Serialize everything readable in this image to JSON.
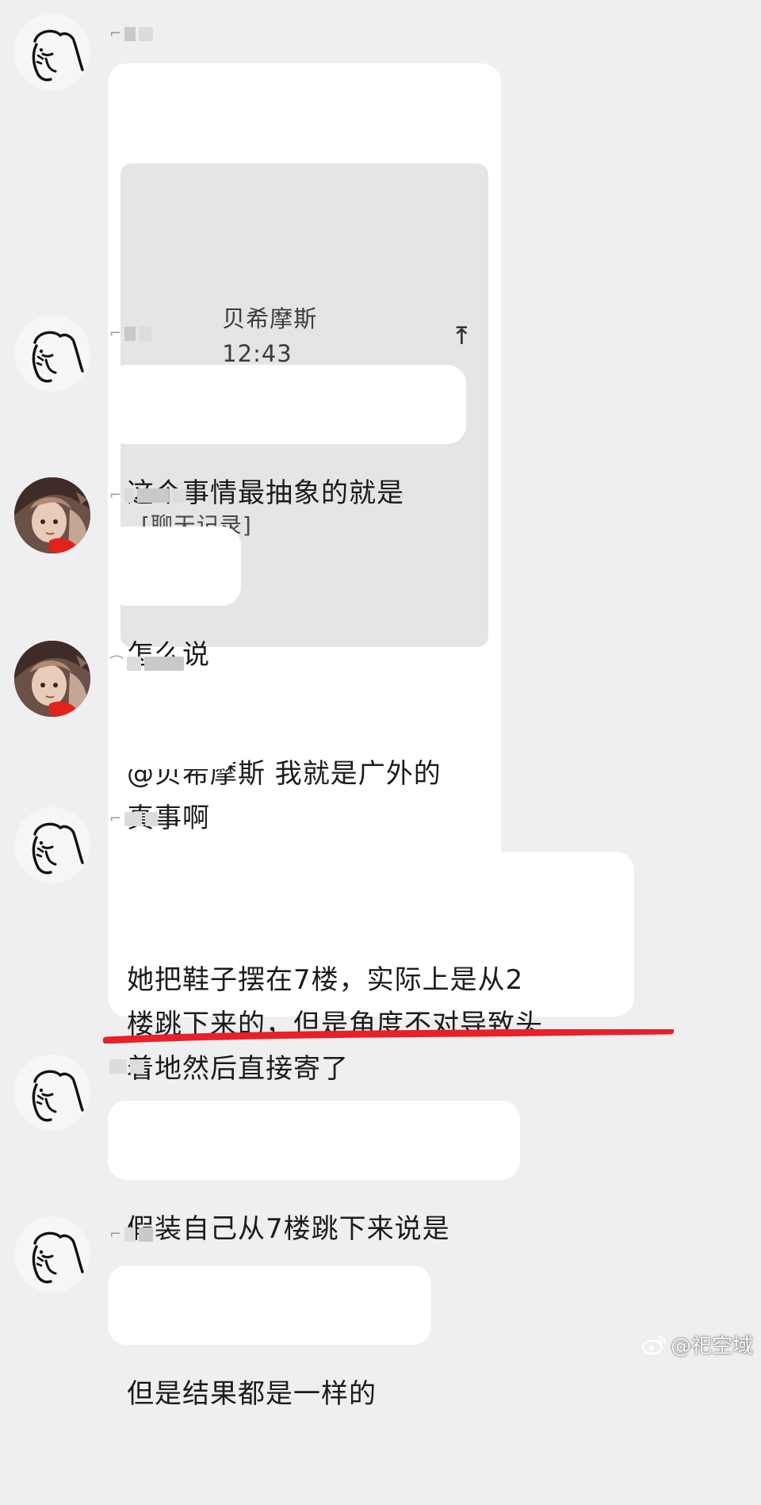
{
  "watermark": {
    "text": "@祀空域"
  },
  "messages": [
    {
      "quote": {
        "sender": "贝希摩斯",
        "time": "12:43",
        "body": "[聊天记录]"
      },
      "text": "@贝希摩斯 我就是广外的"
    },
    {
      "text": "这个事情最抽象的就是"
    },
    {
      "text": "怎么说"
    },
    {
      "text": "真事啊"
    },
    {
      "text": "她把鞋子摆在7楼，实际上是从2\n楼跳下来的，但是角度不对导致头\n着地然后直接寄了"
    },
    {
      "text": "假装自己从7楼跳下来说是"
    },
    {
      "text": "但是结果都是一样的"
    }
  ],
  "colors": {
    "background": "#efeff1",
    "bubble": "#ffffff",
    "quote_bg": "#e5e5e7",
    "underline": "#e8202a"
  },
  "icons": {
    "cartoon_avatar": "doodle-face-icon",
    "photo_avatar": "anime-girl-avatar",
    "quote_jump": "arrow-up-icon",
    "watermark_logo": "weibo-logo-icon"
  }
}
